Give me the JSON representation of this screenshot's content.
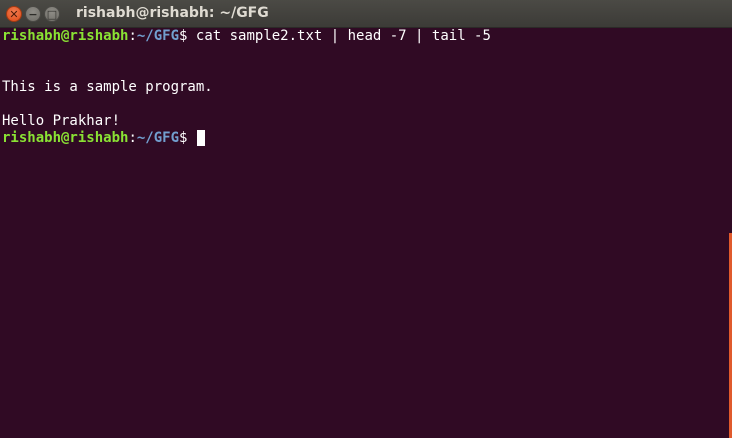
{
  "window": {
    "title": "rishabh@rishabh: ~/GFG",
    "close_glyph": "✕",
    "minimize_glyph": "−",
    "maximize_glyph": "□"
  },
  "terminal": {
    "lines": [
      {
        "type": "prompt",
        "user": "rishabh@rishabh",
        "sep": ":",
        "path": "~/GFG",
        "symbol": "$",
        "command": " cat sample2.txt | head -7 | tail -5"
      },
      {
        "type": "output",
        "text": ""
      },
      {
        "type": "output",
        "text": ""
      },
      {
        "type": "output",
        "text": "This is a sample program."
      },
      {
        "type": "output",
        "text": ""
      },
      {
        "type": "output",
        "text": "Hello Prakhar!"
      },
      {
        "type": "prompt",
        "user": "rishabh@rishabh",
        "sep": ":",
        "path": "~/GFG",
        "symbol": "$",
        "command": " "
      }
    ]
  },
  "colors": {
    "background": "#300a24",
    "prompt_user": "#8ae234",
    "prompt_path": "#729fcf",
    "text": "#ffffff",
    "close_button": "#df4a16"
  }
}
